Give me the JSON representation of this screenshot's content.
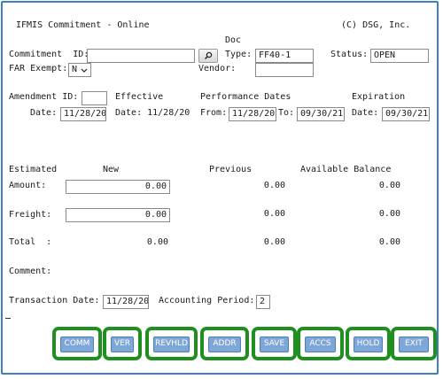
{
  "header": {
    "title": "IFMIS Commitment - Online",
    "copyright": "(C) DSG, Inc.",
    "doc_label": "Doc"
  },
  "commitment": {
    "id_label": "Commitment  ID:",
    "id_value": "",
    "type_label": "Type:",
    "type_value": "FF40-1",
    "status_label": "Status:",
    "status_value": "OPEN",
    "far_label": "FAR Exempt:",
    "far_value": "N",
    "vendor_label": "Vendor:",
    "vendor_value": "",
    "search_icon": "search-icon"
  },
  "dates": {
    "amendment_id_label": "Amendment ID:",
    "amendment_id_value": "",
    "date_label": "Date:",
    "date_value": "11/28/20",
    "effective_label": "Effective",
    "effective_date_text": "Date: 11/28/20",
    "performance_label": "Performance Dates",
    "from_label": "From:",
    "from_value": "11/28/20",
    "to_label": "To:",
    "to_value": "09/30/21",
    "expiration_label": "Expiration",
    "exp_date_label": "Date:",
    "exp_date_value": "09/30/21"
  },
  "amounts": {
    "estimated_label": "Estimated",
    "new_label": "New",
    "previous_label": "Previous",
    "available_label": "Available Balance",
    "amount_label": "Amount:",
    "amount_new": "0.00",
    "amount_previous": "0.00",
    "amount_available": "0.00",
    "freight_label": "Freight:",
    "freight_new": "0.00",
    "freight_previous": "0.00",
    "freight_available": "0.00",
    "total_label": "Total  :",
    "total_new": "0.00",
    "total_previous": "0.00",
    "total_available": "0.00"
  },
  "comment": {
    "label": "Comment:"
  },
  "transaction": {
    "date_label": "Transaction Date:",
    "date_value": "11/28/20",
    "period_label": "Accounting Period:",
    "period_value": "2"
  },
  "buttons": {
    "comm": "COMM",
    "ver": "VER",
    "revhld": "REVHLD",
    "addr": "ADDR",
    "save": "SAVE",
    "accs": "ACCS",
    "hold": "HOLD",
    "exit": "EXIT"
  },
  "colors": {
    "frame": "#3f7fc1",
    "button_fill": "#7ea7d8",
    "highlight": "#1f8f1f"
  }
}
